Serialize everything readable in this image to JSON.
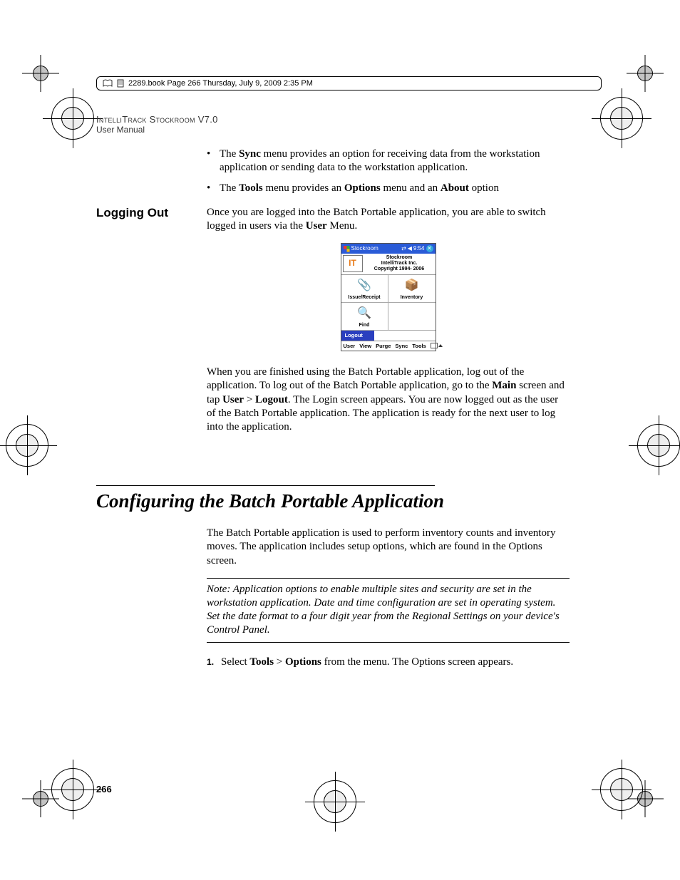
{
  "print_header": "2289.book  Page 266  Thursday, July 9, 2009  2:35 PM",
  "running_head": {
    "title": "IntelliTrack Stockroom V7.0",
    "subtitle": "User Manual"
  },
  "bullets": {
    "b1_pre": "The ",
    "b1_bold": "Sync",
    "b1_post": " menu provides an option for receiving data from the workstation application or sending data to the workstation application.",
    "b2_pre": "The ",
    "b2_b1": "Tools",
    "b2_mid1": " menu provides an ",
    "b2_b2": "Options",
    "b2_mid2": " menu and an ",
    "b2_b3": "About",
    "b2_post": " option"
  },
  "logging_out": {
    "label": "Logging Out",
    "intro_pre": "Once you are logged into the Batch Portable application, you are able to switch logged in users via the ",
    "intro_bold": "User",
    "intro_post": " Menu.",
    "outro_1": "When you are finished using the Batch Portable application, log out of the application. To log out of the Batch Portable application, go to the ",
    "outro_b1": "Main",
    "outro_2": " screen and tap ",
    "outro_b2": "User",
    "gt": " > ",
    "outro_b3": "Logout",
    "outro_3": ". The Login screen appears. You are now logged out as the user of the Batch Portable application. The application is ready for the next user to log into the application."
  },
  "screenshot": {
    "title": "Stockroom",
    "status": "9:54",
    "brand1": "Stockroom",
    "brand2": "IntelliTrack Inc.",
    "brand3": "Copyright 1994- 2006",
    "cell1": "Issue/Receipt",
    "cell2": "Inventory",
    "cell3": "Find",
    "popup": "Logout",
    "menu": {
      "m1": "User",
      "m2": "View",
      "m3": "Purge",
      "m4": "Sync",
      "m5": "Tools"
    }
  },
  "section": {
    "title": "Configuring the Batch Portable Application",
    "para": "The Batch Portable application is used to perform inventory counts and inventory moves. The application includes setup options, which are found in the Options screen.",
    "note": "Note:   Application options to enable multiple sites and security are set in the workstation application. Date and time configuration are set in operating system. Set the date format to a four digit year from the Regional Settings on your device's Control Panel.",
    "step1_pre": "Select ",
    "step1_b1": "Tools",
    "step1_gt": " > ",
    "step1_b2": "Options",
    "step1_post": " from the menu. The Options screen appears."
  },
  "page_number": "266"
}
